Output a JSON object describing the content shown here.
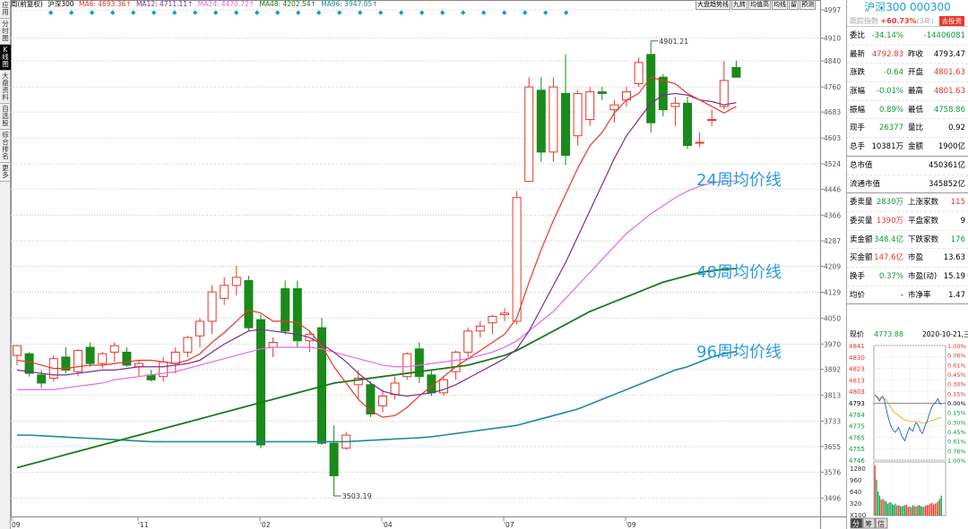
{
  "left_toolbar": [
    {
      "label": "应用",
      "active": false
    },
    {
      "label": "分时图",
      "active": false
    },
    {
      "label": "K线图",
      "active": true
    },
    {
      "label": "大盘资料",
      "active": false
    },
    {
      "label": "自选股",
      "active": false
    },
    {
      "label": "综合排名",
      "active": false
    },
    {
      "label": "更多",
      "active": false
    }
  ],
  "header": {
    "mode": "周(前复权)",
    "code": "沪深300",
    "ma6": "MA6: 4693.36↑",
    "ma12": "MA12: 4711.11↑",
    "ma24": "MA24: 4470.72↑",
    "ma48": "MA48: 4202.54↑",
    "ma96": "MA96: 3947.05↑",
    "colors": {
      "ma6": "#e8372c",
      "ma12": "#7a2e8c",
      "ma24": "#e868e0",
      "ma48": "#1a7a1a",
      "ma96": "#1f8a9a"
    }
  },
  "period_buttons": [
    "大盘趋势线",
    "九转",
    "均值高",
    "均线",
    "留",
    "预测"
  ],
  "chart_data": {
    "type": "candlestick",
    "ylim": [
      3440,
      4997
    ],
    "y_ticks": [
      "4997",
      "4910",
      "4840",
      "4760",
      "4683",
      "4603",
      "4524",
      "4446",
      "4366",
      "4287",
      "4209",
      "4129",
      "4050",
      "3970",
      "3892",
      "3813",
      "3733",
      "3655",
      "3576",
      "3496"
    ],
    "x_labels": [
      "09",
      "'11",
      "'02",
      "'04",
      "'07",
      "'09"
    ],
    "annotations": {
      "high": "4901.21",
      "low": "3503.19"
    },
    "ma_labels": {
      "ma24": "24周均价线",
      "ma48": "48周均价线",
      "ma96": "96周均价线"
    },
    "candles": [
      {
        "o": 3935,
        "h": 3965,
        "l": 3905,
        "c": 3965
      },
      {
        "o": 3940,
        "h": 3945,
        "l": 3870,
        "c": 3880
      },
      {
        "o": 3875,
        "h": 3890,
        "l": 3835,
        "c": 3850
      },
      {
        "o": 3865,
        "h": 3935,
        "l": 3855,
        "c": 3925
      },
      {
        "o": 3930,
        "h": 3960,
        "l": 3880,
        "c": 3890
      },
      {
        "o": 3885,
        "h": 3955,
        "l": 3870,
        "c": 3950
      },
      {
        "o": 3960,
        "h": 3975,
        "l": 3900,
        "c": 3910
      },
      {
        "o": 3910,
        "h": 3945,
        "l": 3895,
        "c": 3940
      },
      {
        "o": 3945,
        "h": 3975,
        "l": 3915,
        "c": 3965
      },
      {
        "o": 3945,
        "h": 3960,
        "l": 3900,
        "c": 3905
      },
      {
        "o": 3900,
        "h": 3920,
        "l": 3870,
        "c": 3910
      },
      {
        "o": 3875,
        "h": 3890,
        "l": 3855,
        "c": 3860
      },
      {
        "o": 3870,
        "h": 3930,
        "l": 3855,
        "c": 3915
      },
      {
        "o": 3910,
        "h": 3960,
        "l": 3880,
        "c": 3945
      },
      {
        "o": 3945,
        "h": 3995,
        "l": 3930,
        "c": 3990
      },
      {
        "o": 3995,
        "h": 4050,
        "l": 3960,
        "c": 4040
      },
      {
        "o": 4040,
        "h": 4150,
        "l": 4000,
        "c": 4130
      },
      {
        "o": 4110,
        "h": 4175,
        "l": 4090,
        "c": 4150
      },
      {
        "o": 4150,
        "h": 4210,
        "l": 4120,
        "c": 4175
      },
      {
        "o": 4165,
        "h": 4180,
        "l": 4010,
        "c": 4020
      },
      {
        "o": 4045,
        "h": 4060,
        "l": 3650,
        "c": 3660
      },
      {
        "o": 3960,
        "h": 3990,
        "l": 3930,
        "c": 3975
      },
      {
        "o": 4140,
        "h": 4165,
        "l": 4000,
        "c": 4010
      },
      {
        "o": 4140,
        "h": 4165,
        "l": 3960,
        "c": 3980
      },
      {
        "o": 3980,
        "h": 4010,
        "l": 3945,
        "c": 4000
      },
      {
        "o": 4020,
        "h": 4050,
        "l": 3660,
        "c": 3665
      },
      {
        "o": 3665,
        "h": 3720,
        "l": 3503,
        "c": 3565
      },
      {
        "o": 3650,
        "h": 3700,
        "l": 3645,
        "c": 3690
      },
      {
        "o": 3845,
        "h": 3890,
        "l": 3800,
        "c": 3865
      },
      {
        "o": 3845,
        "h": 3855,
        "l": 3745,
        "c": 3755
      },
      {
        "o": 3780,
        "h": 3830,
        "l": 3760,
        "c": 3810
      },
      {
        "o": 3815,
        "h": 3870,
        "l": 3800,
        "c": 3850
      },
      {
        "o": 3870,
        "h": 3945,
        "l": 3860,
        "c": 3940
      },
      {
        "o": 3955,
        "h": 3975,
        "l": 3850,
        "c": 3870
      },
      {
        "o": 3875,
        "h": 3890,
        "l": 3810,
        "c": 3820
      },
      {
        "o": 3820,
        "h": 3870,
        "l": 3810,
        "c": 3860
      },
      {
        "o": 3885,
        "h": 3950,
        "l": 3860,
        "c": 3945
      },
      {
        "o": 3945,
        "h": 4020,
        "l": 3930,
        "c": 4010
      },
      {
        "o": 4010,
        "h": 4040,
        "l": 3990,
        "c": 4025
      },
      {
        "o": 4035,
        "h": 4060,
        "l": 4000,
        "c": 4055
      },
      {
        "o": 4060,
        "h": 4080,
        "l": 4040,
        "c": 4065
      },
      {
        "o": 4040,
        "h": 4440,
        "l": 4030,
        "c": 4420
      },
      {
        "o": 4470,
        "h": 4790,
        "l": 4470,
        "c": 4760
      },
      {
        "o": 4750,
        "h": 4790,
        "l": 4530,
        "c": 4560
      },
      {
        "o": 4560,
        "h": 4790,
        "l": 4530,
        "c": 4760
      },
      {
        "o": 4740,
        "h": 4860,
        "l": 4520,
        "c": 4550
      },
      {
        "o": 4610,
        "h": 4750,
        "l": 4580,
        "c": 4740
      },
      {
        "o": 4660,
        "h": 4760,
        "l": 4640,
        "c": 4745
      },
      {
        "o": 4745,
        "h": 4760,
        "l": 4720,
        "c": 4740
      },
      {
        "o": 4690,
        "h": 4720,
        "l": 4650,
        "c": 4705
      },
      {
        "o": 4720,
        "h": 4760,
        "l": 4700,
        "c": 4745
      },
      {
        "o": 4770,
        "h": 4850,
        "l": 4760,
        "c": 4835
      },
      {
        "o": 4860,
        "h": 4901,
        "l": 4620,
        "c": 4650
      },
      {
        "o": 4790,
        "h": 4800,
        "l": 4670,
        "c": 4690
      },
      {
        "o": 4700,
        "h": 4730,
        "l": 4640,
        "c": 4710
      },
      {
        "o": 4710,
        "h": 4730,
        "l": 4570,
        "c": 4580
      },
      {
        "o": 4590,
        "h": 4620,
        "l": 4575,
        "c": 4590
      },
      {
        "o": 4660,
        "h": 4690,
        "l": 4640,
        "c": 4660
      },
      {
        "o": 4700,
        "h": 4840,
        "l": 4690,
        "c": 4780
      },
      {
        "o": 4820,
        "h": 4840,
        "l": 4790,
        "c": 4790
      }
    ],
    "ma6": [
      3920,
      3915,
      3905,
      3895,
      3895,
      3900,
      3905,
      3905,
      3910,
      3915,
      3920,
      3920,
      3915,
      3910,
      3920,
      3940,
      3975,
      4005,
      4040,
      4075,
      4065,
      4040,
      4040,
      4035,
      4010,
      3965,
      3900,
      3850,
      3800,
      3765,
      3745,
      3750,
      3775,
      3810,
      3840,
      3870,
      3900,
      3925,
      3950,
      3975,
      4000,
      4050,
      4160,
      4260,
      4350,
      4430,
      4510,
      4580,
      4620,
      4680,
      4720,
      4740,
      4790,
      4780,
      4770,
      4740,
      4720,
      4700,
      4680,
      4700
    ],
    "ma12": [
      3890,
      3885,
      3880,
      3875,
      3875,
      3880,
      3885,
      3890,
      3890,
      3895,
      3900,
      3900,
      3900,
      3905,
      3910,
      3920,
      3945,
      3970,
      3990,
      4010,
      4015,
      4010,
      4005,
      4000,
      3990,
      3970,
      3945,
      3915,
      3880,
      3850,
      3825,
      3815,
      3810,
      3815,
      3820,
      3830,
      3845,
      3865,
      3885,
      3905,
      3925,
      3955,
      4010,
      4080,
      4150,
      4220,
      4300,
      4380,
      4460,
      4540,
      4610,
      4660,
      4710,
      4735,
      4740,
      4735,
      4720,
      4715,
      4705,
      4712
    ],
    "ma24": [
      3830,
      3830,
      3830,
      3830,
      3835,
      3840,
      3845,
      3850,
      3860,
      3865,
      3870,
      3875,
      3880,
      3885,
      3895,
      3905,
      3915,
      3925,
      3935,
      3945,
      3955,
      3960,
      3960,
      3960,
      3960,
      3955,
      3945,
      3935,
      3925,
      3915,
      3905,
      3900,
      3900,
      3905,
      3910,
      3915,
      3920,
      3925,
      3935,
      3945,
      3960,
      3980,
      4010,
      4040,
      4070,
      4110,
      4150,
      4190,
      4230,
      4270,
      4310,
      4340,
      4370,
      4395,
      4420,
      4440,
      4455,
      4465,
      4470,
      4471
    ],
    "ma48": [
      3590,
      3600,
      3610,
      3620,
      3630,
      3640,
      3650,
      3660,
      3670,
      3680,
      3690,
      3700,
      3710,
      3720,
      3730,
      3740,
      3750,
      3760,
      3770,
      3780,
      3790,
      3800,
      3810,
      3820,
      3830,
      3840,
      3850,
      3855,
      3860,
      3865,
      3870,
      3875,
      3880,
      3885,
      3890,
      3895,
      3900,
      3905,
      3915,
      3925,
      3935,
      3950,
      3970,
      3990,
      4010,
      4030,
      4050,
      4070,
      4085,
      4100,
      4115,
      4130,
      4145,
      4160,
      4170,
      4180,
      4190,
      4195,
      4200,
      4202
    ],
    "ma96": [
      3690,
      3690,
      3688,
      3686,
      3684,
      3682,
      3680,
      3678,
      3676,
      3674,
      3672,
      3670,
      3670,
      3670,
      3670,
      3670,
      3670,
      3670,
      3670,
      3670,
      3670,
      3670,
      3670,
      3670,
      3670,
      3670,
      3670,
      3670,
      3672,
      3674,
      3676,
      3678,
      3680,
      3682,
      3685,
      3690,
      3695,
      3700,
      3705,
      3710,
      3715,
      3720,
      3730,
      3740,
      3750,
      3760,
      3770,
      3785,
      3800,
      3815,
      3830,
      3845,
      3860,
      3875,
      3890,
      3900,
      3915,
      3930,
      3940,
      3947
    ]
  },
  "right_panel": {
    "title": "沪深300 000300",
    "sub_blur": "跟踪指数",
    "sub_pct": "+60.73%",
    "sub_suffix": "(3年)",
    "sub_btn": "去投资",
    "rows": [
      {
        "l1": "委比",
        "v1": "-34.14%",
        "c1": "green",
        "l2": "",
        "v2": "-14406081",
        "c2": "green"
      },
      {
        "l1": "最新",
        "v1": "4792.83",
        "c1": "red",
        "l2": "昨收",
        "v2": "4793.47",
        "c2": "blk"
      },
      {
        "l1": "涨跌",
        "v1": "-0.64",
        "c1": "green",
        "l2": "开盘",
        "v2": "4801.63",
        "c2": "red"
      },
      {
        "l1": "涨幅",
        "v1": "-0.01%",
        "c1": "green",
        "l2": "最高",
        "v2": "4801.63",
        "c2": "red"
      },
      {
        "l1": "振幅",
        "v1": "0.89%",
        "c1": "green",
        "l2": "最低",
        "v2": "4758.86",
        "c2": "green"
      },
      {
        "l1": "现手",
        "v1": "26377",
        "c1": "green",
        "l2": "量比",
        "v2": "0.92",
        "c2": "blk"
      },
      {
        "l1": "总手",
        "v1": "10381万",
        "c1": "blk",
        "l2": "金额",
        "v2": "1900亿",
        "c2": "blk",
        "sep": true
      },
      {
        "l1": "总市值",
        "v1": "",
        "c1": "blk",
        "l2": "",
        "v2": "450361亿",
        "c2": "blk"
      },
      {
        "l1": "流通市值",
        "v1": "",
        "c1": "blk",
        "l2": "",
        "v2": "345852亿",
        "c2": "blk",
        "sep": true
      },
      {
        "l1": "委卖量",
        "v1": "2830万",
        "c1": "green",
        "l2": "上涨家数",
        "v2": "115",
        "c2": "red"
      },
      {
        "l1": "委买量",
        "v1": "1390万",
        "c1": "red",
        "l2": "平盘家数",
        "v2": "9",
        "c2": "blk"
      },
      {
        "l1": "卖金额",
        "v1": "348.4亿",
        "c1": "green",
        "l2": "下跌家数",
        "v2": "176",
        "c2": "green"
      },
      {
        "l1": "买金额",
        "v1": "147.6亿",
        "c1": "red",
        "l2": "市盈",
        "v2": "13.63",
        "c2": "blk"
      },
      {
        "l1": "换手",
        "v1": "0.37%",
        "c1": "green",
        "l2": "市盈(动)",
        "v2": "15.19",
        "c2": "blk"
      },
      {
        "l1": "均价",
        "v1": "-",
        "c1": "blk",
        "l2": "市净率",
        "v2": "1.47",
        "c2": "blk",
        "sep": true
      }
    ],
    "mini": {
      "header_label": "现价",
      "header_value": "4773.88",
      "header_date": "2020-10-21,三",
      "left_ticks": [
        "4841",
        "4830",
        "4823",
        "4813",
        "4803",
        "4793",
        "4784",
        "4775",
        "4765",
        "4755",
        "4746"
      ],
      "right_ticks": [
        "1.00%",
        "0.76%",
        "0.61%",
        "0.45%",
        "0.30%",
        "0.15%",
        "0.00%",
        "0.15%",
        "0.30%",
        "0.45%",
        "0.61%",
        "0.76%",
        "1.00%"
      ],
      "vol_ticks": [
        "1280",
        "960",
        "640",
        "320",
        "X100"
      ],
      "price": [
        4800,
        4799,
        4797,
        4795,
        4798,
        4799,
        4796,
        4790,
        4784,
        4779,
        4775,
        4772,
        4770,
        4769,
        4771,
        4773,
        4770,
        4766,
        4764,
        4762,
        4766,
        4770,
        4773,
        4771,
        4770,
        4774,
        4777,
        4776,
        4773,
        4770,
        4768,
        4771,
        4775,
        4778,
        4782,
        4786,
        4790,
        4792,
        4793,
        4795,
        4797,
        4793,
        4792
      ],
      "avg": [
        4800,
        4799,
        4798,
        4797,
        4797,
        4797,
        4797,
        4796,
        4794,
        4792,
        4790,
        4788,
        4786,
        4785,
        4784,
        4783,
        4782,
        4781,
        4780,
        4779,
        4779,
        4779,
        4778,
        4778,
        4778,
        4778,
        4778,
        4778,
        4778,
        4777,
        4777,
        4777,
        4777,
        4777,
        4778,
        4778,
        4779,
        4779,
        4780,
        4780,
        4781,
        4781,
        4781
      ],
      "volumes": [
        1250,
        900,
        600,
        500,
        400,
        420,
        380,
        350,
        300,
        320,
        340,
        280,
        260,
        300,
        250,
        260,
        240,
        230,
        250,
        260,
        270,
        220,
        230,
        210,
        260,
        240,
        230,
        250,
        260,
        240,
        230,
        220,
        250,
        260,
        270,
        300,
        320,
        280,
        300,
        320,
        360,
        420,
        500
      ],
      "tabs": [
        "分",
        "筹",
        "信"
      ]
    }
  }
}
